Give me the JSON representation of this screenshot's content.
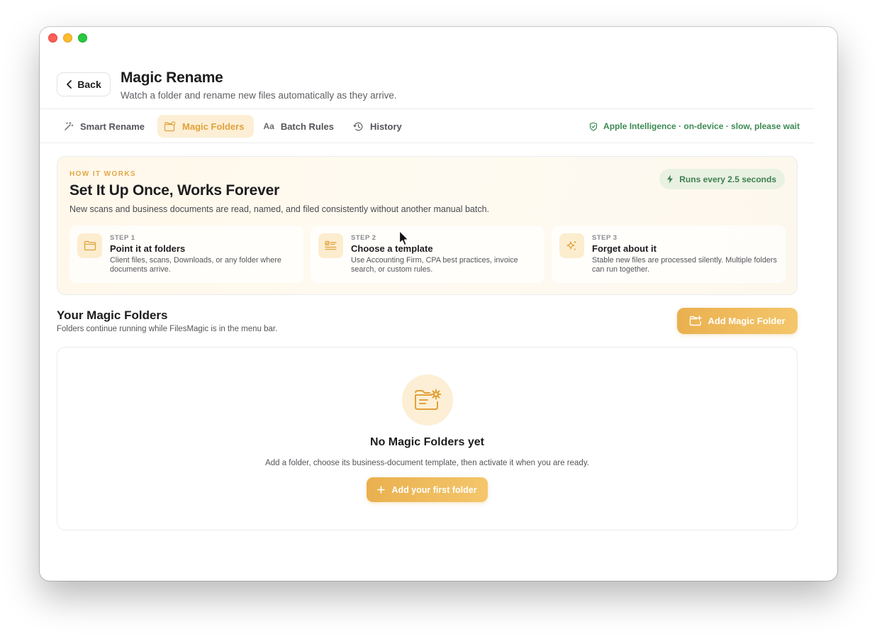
{
  "header": {
    "back_label": "Back",
    "title": "Magic Rename",
    "subtitle": "Watch a folder and rename new files automatically as they arrive."
  },
  "tabs": [
    {
      "label": "Smart Rename",
      "icon": "magic-wand-icon",
      "active": false
    },
    {
      "label": "Magic Folders",
      "icon": "folder-badge-icon",
      "active": true
    },
    {
      "label": "Batch Rules",
      "icon": "text-aa-icon",
      "active": false
    },
    {
      "label": "History",
      "icon": "clock-history-icon",
      "active": false
    }
  ],
  "ai_status": {
    "icon": "shield-check-icon",
    "text": "Apple Intelligence · on-device · slow, please wait"
  },
  "how_it_works": {
    "eyebrow": "HOW IT WORKS",
    "title": "Set It Up Once, Works Forever",
    "description": "New scans and business documents are read, named, and filed consistently without another manual batch.",
    "badge": "Runs every 2.5 seconds",
    "steps": [
      {
        "num": "STEP 1",
        "title": "Point it at folders",
        "desc": "Client files, scans, Downloads, or any folder where documents arrive.",
        "icon": "folder-icon"
      },
      {
        "num": "STEP 2",
        "title": "Choose a template",
        "desc": "Use Accounting Firm, CPA best practices, invoice search, or custom rules.",
        "icon": "checklist-icon"
      },
      {
        "num": "STEP 3",
        "title": "Forget about it",
        "desc": "Stable new files are processed silently. Multiple folders can run together.",
        "icon": "sparkles-icon"
      }
    ]
  },
  "folders": {
    "title": "Your Magic Folders",
    "subtitle": "Folders continue running while FilesMagic is in the menu bar.",
    "add_label": "Add Magic Folder",
    "empty_title": "No Magic Folders yet",
    "empty_desc": "Add a folder, choose its business-document template, then activate it when you are ready.",
    "first_folder_label": "Add your first folder"
  },
  "colors": {
    "accent": "#e8a93f",
    "accent_bg": "#fcefd5",
    "success_text": "#3d8a53",
    "success_bg": "#e9f1e3"
  }
}
